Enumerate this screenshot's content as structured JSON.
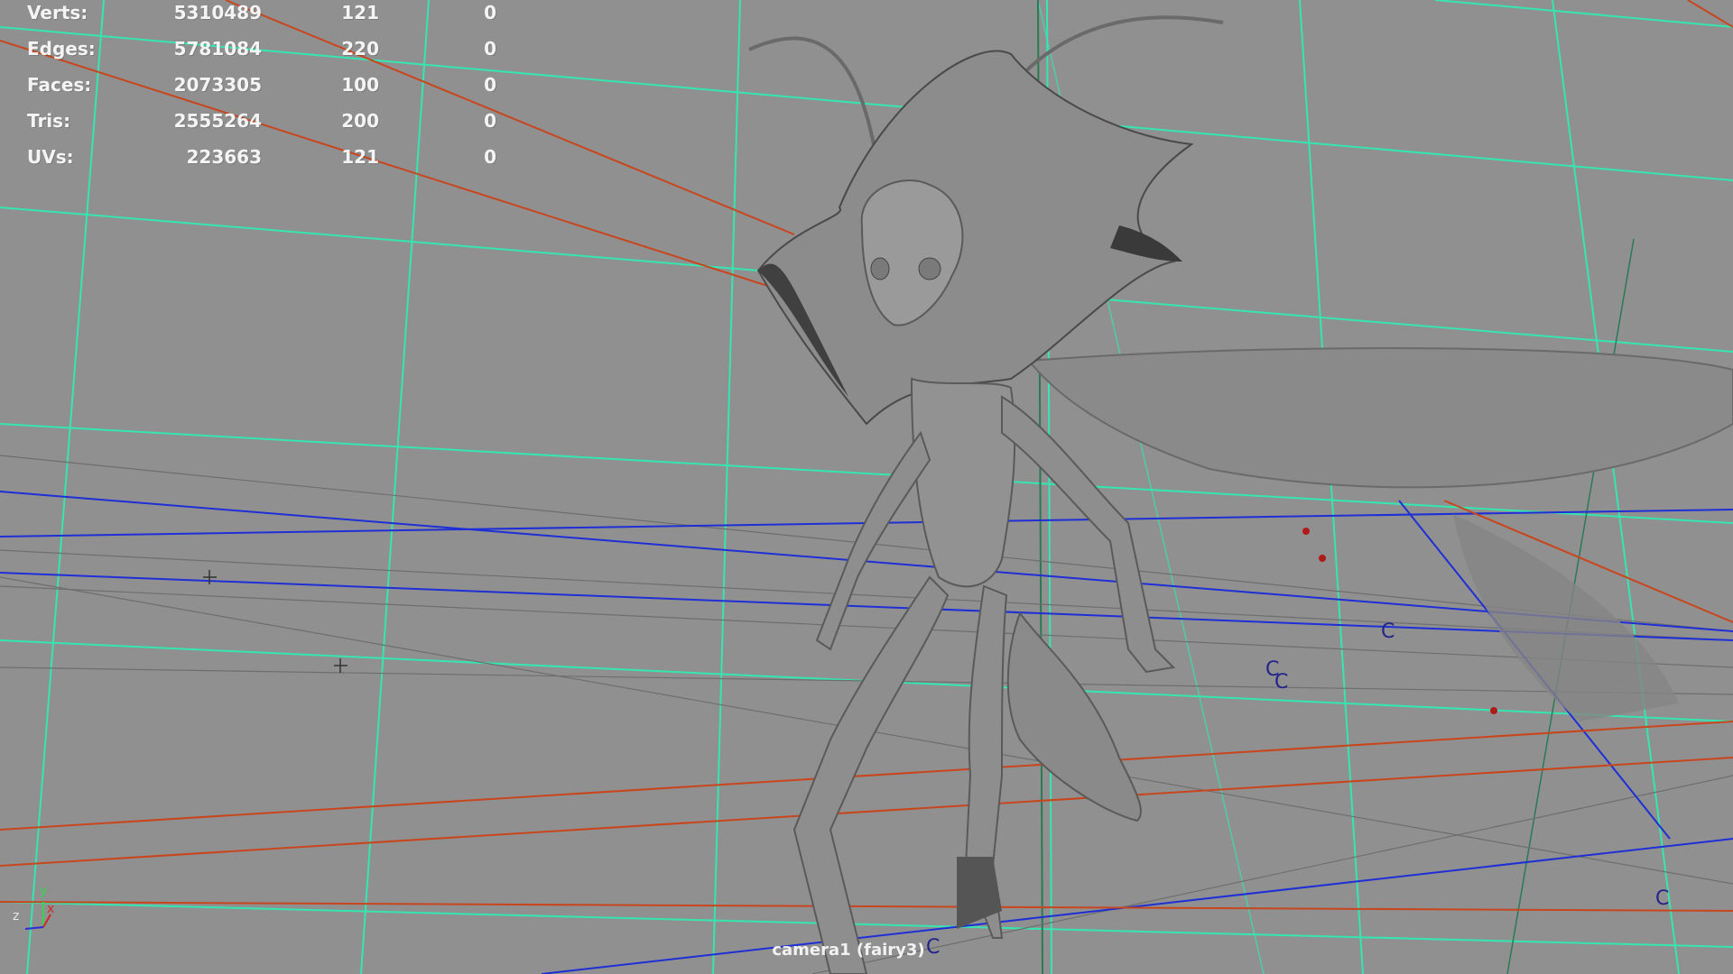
{
  "hud": {
    "rows": [
      {
        "label": "Verts:",
        "total": "5310489",
        "selected": "121",
        "highlighted": "0"
      },
      {
        "label": "Edges:",
        "total": "5781084",
        "selected": "220",
        "highlighted": "0"
      },
      {
        "label": "Faces:",
        "total": "2073305",
        "selected": "100",
        "highlighted": "0"
      },
      {
        "label": "Tris:",
        "total": "2555264",
        "selected": "200",
        "highlighted": "0"
      },
      {
        "label": "UVs:",
        "total": "223663",
        "selected": "121",
        "highlighted": "0"
      }
    ]
  },
  "viewport": {
    "camera_label": "camera1 (fairy3)",
    "background_color": "#909090",
    "grid_color": "#35e6b0",
    "curve_color_blue": "#1e2fd6",
    "curve_color_red": "#c8461e"
  },
  "axis_gizmo": {
    "y_label": "y",
    "z_label": "z",
    "x_label": "x"
  },
  "markers": {
    "c1": "C",
    "c2": "C",
    "c3": "C",
    "c4": "C",
    "c5": "C",
    "c6": "C"
  }
}
